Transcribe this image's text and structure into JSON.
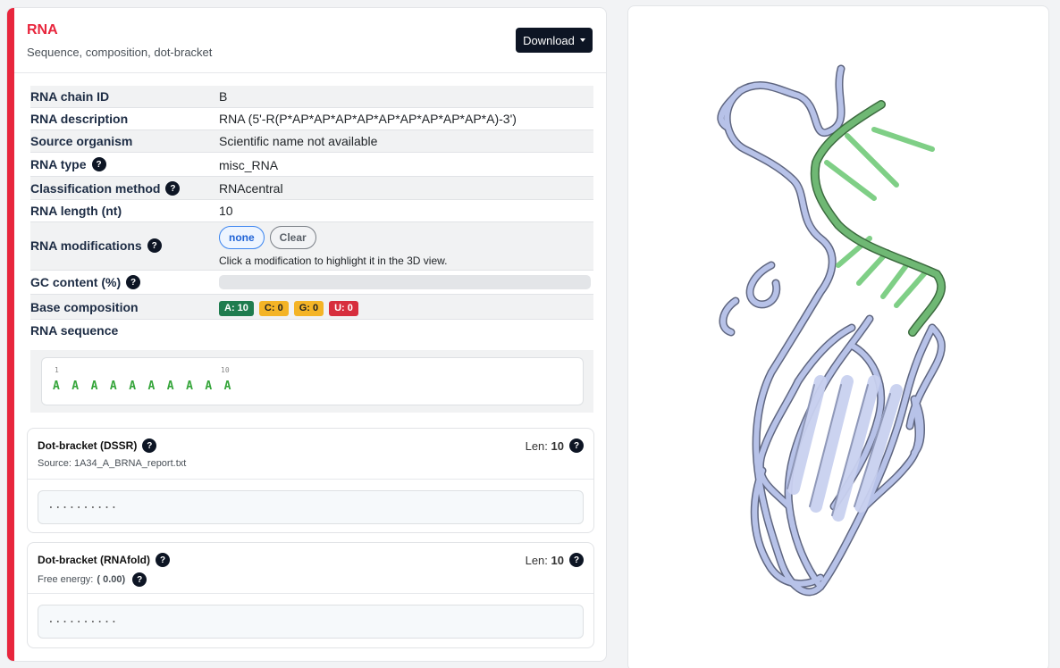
{
  "header": {
    "title": "RNA",
    "subtitle": "Sequence, composition, dot-bracket",
    "download_label": "Download"
  },
  "info": {
    "chain_id_label": "RNA chain ID",
    "chain_id": "B",
    "description_label": "RNA description",
    "description": "RNA (5'-R(P*AP*AP*AP*AP*AP*AP*AP*AP*AP*A)-3')",
    "organism_label": "Source organism",
    "organism": "Scientific name not available",
    "type_label": "RNA type",
    "type": "misc_RNA",
    "classification_label": "Classification method",
    "classification": "RNAcentral",
    "length_label": "RNA length (nt)",
    "length": "10",
    "modifications_label": "RNA modifications",
    "mod_none": "none",
    "mod_clear": "Clear",
    "mod_hint": "Click a modification to highlight it in the 3D view.",
    "gc_label": "GC content (%)",
    "gc_value": 0,
    "composition_label": "Base composition",
    "comp_a": "A: 10",
    "comp_c": "C: 0",
    "comp_g": "G: 0",
    "comp_u": "U: 0",
    "sequence_label": "RNA sequence"
  },
  "sequence": {
    "start_num": "1",
    "end_num": "10",
    "letters": [
      "A",
      "A",
      "A",
      "A",
      "A",
      "A",
      "A",
      "A",
      "A",
      "A"
    ]
  },
  "dssr": {
    "title": "Dot-bracket (DSSR)",
    "source": "Source: 1A34_A_BRNA_report.txt",
    "len_label": "Len:",
    "len_value": "10",
    "dots": ".........."
  },
  "rnafold": {
    "title": "Dot-bracket (RNAfold)",
    "energy_label": "Free energy:",
    "energy_value": "( 0.00)",
    "len_label": "Len:",
    "len_value": "10",
    "dots": ".........."
  },
  "icons": {
    "help": "?"
  },
  "colors": {
    "accent": "#e8263d",
    "protein": "#aab4dc",
    "rna": "#7fcf86",
    "a_badge": "#1f7c4e",
    "c_badge": "#f4b426",
    "g_badge": "#f4b426",
    "u_badge": "#d72e3d"
  }
}
